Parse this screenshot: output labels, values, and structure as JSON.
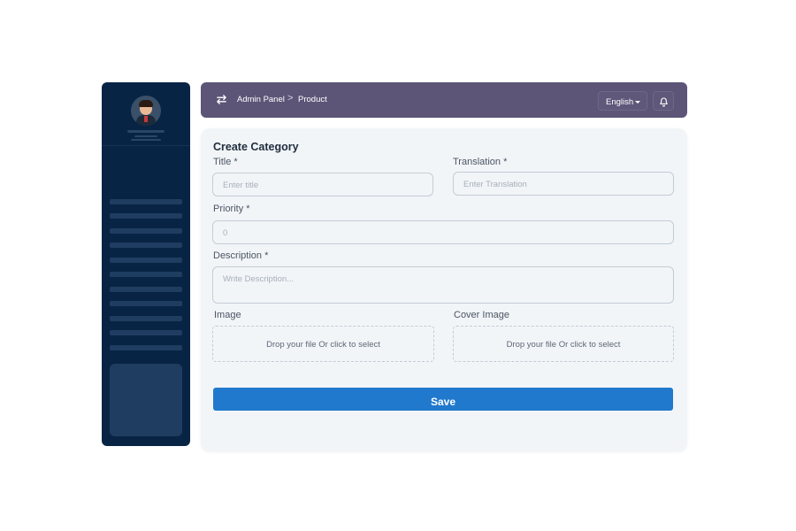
{
  "header": {
    "breadcrumb_root": "Admin Panel",
    "breadcrumb_separator": ">",
    "breadcrumb_current": "Product",
    "language": "English",
    "icons": {
      "menu_toggle": "swap-arrows-icon",
      "notifications": "bell-icon"
    }
  },
  "form": {
    "title": "Create Category",
    "fields": {
      "title": {
        "label": "Title *",
        "placeholder": "Enter title"
      },
      "translation": {
        "label": "Translation *",
        "placeholder": "Enter Translation"
      },
      "priority": {
        "label": "Priority *",
        "value": "0"
      },
      "description": {
        "label": "Description *",
        "placeholder": "Write Description..."
      },
      "image": {
        "label": "Image",
        "drop_text": "Drop your file Or click to select"
      },
      "cover_image": {
        "label": "Cover Image",
        "drop_text": "Drop your file Or click to select"
      }
    },
    "save_label": "Save"
  },
  "colors": {
    "sidebar_bg": "#082445",
    "header_bg": "#5c5577",
    "card_bg": "#f2f5f8",
    "primary_button": "#2079cc"
  }
}
